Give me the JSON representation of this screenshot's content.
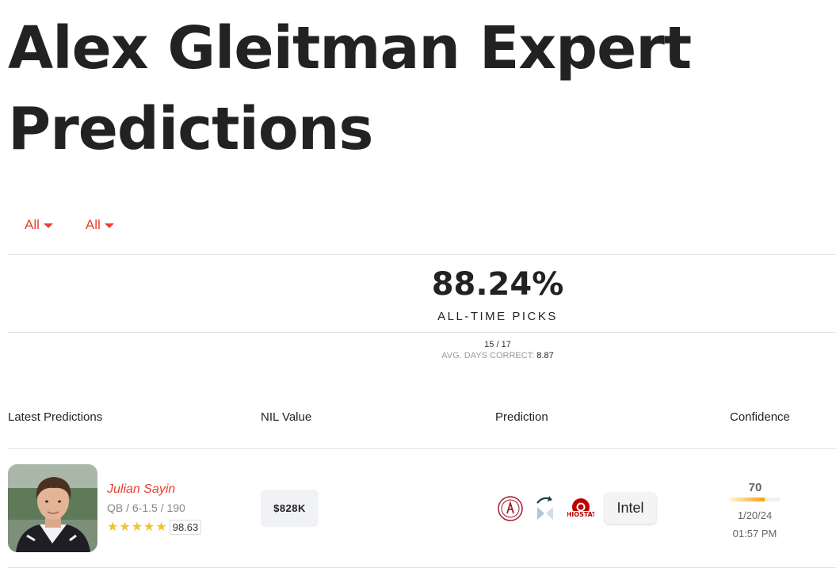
{
  "page": {
    "title_line1": "Alex Gleitman Expert",
    "title_line2": "Predictions"
  },
  "filters": [
    {
      "label": "All"
    },
    {
      "label": "All"
    }
  ],
  "stats": {
    "percent": "88.24%",
    "label": "ALL-TIME PICKS",
    "ratio": "15 / 17",
    "avg_label": "AVG. DAYS CORRECT:",
    "avg_value": "8.87"
  },
  "columns": {
    "latest": "Latest Predictions",
    "nil": "NIL Value",
    "prediction": "Prediction",
    "confidence": "Confidence"
  },
  "predictions": [
    {
      "name": "Julian Sayin",
      "info": "QB / 6-1.5 / 190",
      "stars": 5,
      "rating": "98.63",
      "nil_value": "$828K",
      "from_team_icon": "alabama-logo-icon",
      "transition_icon": "crystal-ball-flip-icon",
      "to_team_icon": "ohio-state-logo-icon",
      "status": "Intel",
      "confidence": "70",
      "confidence_fraction": 0.7,
      "date": "1/20/24",
      "time": "01:57 PM"
    }
  ],
  "colors": {
    "accent": "#e8402e",
    "star": "#f1c232",
    "text": "#222222",
    "muted": "#888888",
    "ohio_state_red": "#bb0000",
    "alabama_crimson": "#9e1b32"
  }
}
